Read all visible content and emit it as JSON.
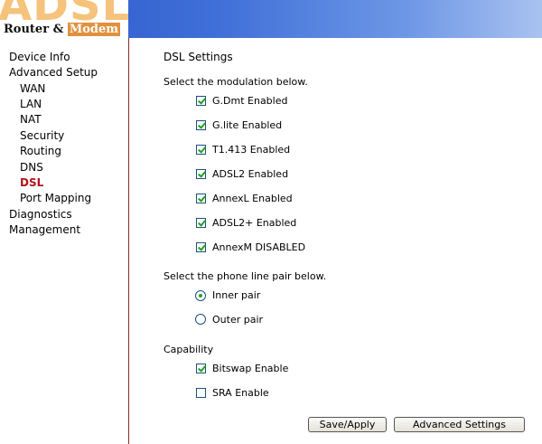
{
  "header": {
    "logo_text": "ADSL",
    "logo_sub_router": "Router &",
    "logo_sub_modem": "Modem",
    "colors": {
      "band_start": "#2a57c8",
      "band_end": "#a9c2f0",
      "logo_orange": "#f6c37d"
    }
  },
  "sidebar": {
    "items": [
      {
        "label": "Device Info"
      },
      {
        "label": "Advanced Setup"
      },
      {
        "label": "WAN"
      },
      {
        "label": "LAN"
      },
      {
        "label": "NAT"
      },
      {
        "label": "Security"
      },
      {
        "label": "Routing"
      },
      {
        "label": "DNS"
      },
      {
        "label": "DSL",
        "active": true
      },
      {
        "label": "Port Mapping"
      },
      {
        "label": "Diagnostics"
      },
      {
        "label": "Management"
      }
    ],
    "active_color": "#b0121b"
  },
  "main": {
    "title": "DSL Settings",
    "modulation_prompt": "Select the modulation below.",
    "modulations": [
      {
        "label": "G.Dmt Enabled",
        "checked": true
      },
      {
        "label": "G.lite Enabled",
        "checked": true
      },
      {
        "label": "T1.413 Enabled",
        "checked": true
      },
      {
        "label": "ADSL2 Enabled",
        "checked": true
      },
      {
        "label": "AnnexL Enabled",
        "checked": true
      },
      {
        "label": "ADSL2+ Enabled",
        "checked": true
      },
      {
        "label": "AnnexM DISABLED",
        "checked": true
      }
    ],
    "pair_prompt": "Select the phone line pair below.",
    "pairs": [
      {
        "label": "Inner pair",
        "selected": true
      },
      {
        "label": "Outer pair",
        "selected": false
      }
    ],
    "capability_title": "Capability",
    "capabilities": [
      {
        "label": "Bitswap Enable",
        "checked": true
      },
      {
        "label": "SRA Enable",
        "checked": false
      }
    ],
    "buttons": {
      "save": "Save/Apply",
      "advanced": "Advanced Settings"
    }
  }
}
